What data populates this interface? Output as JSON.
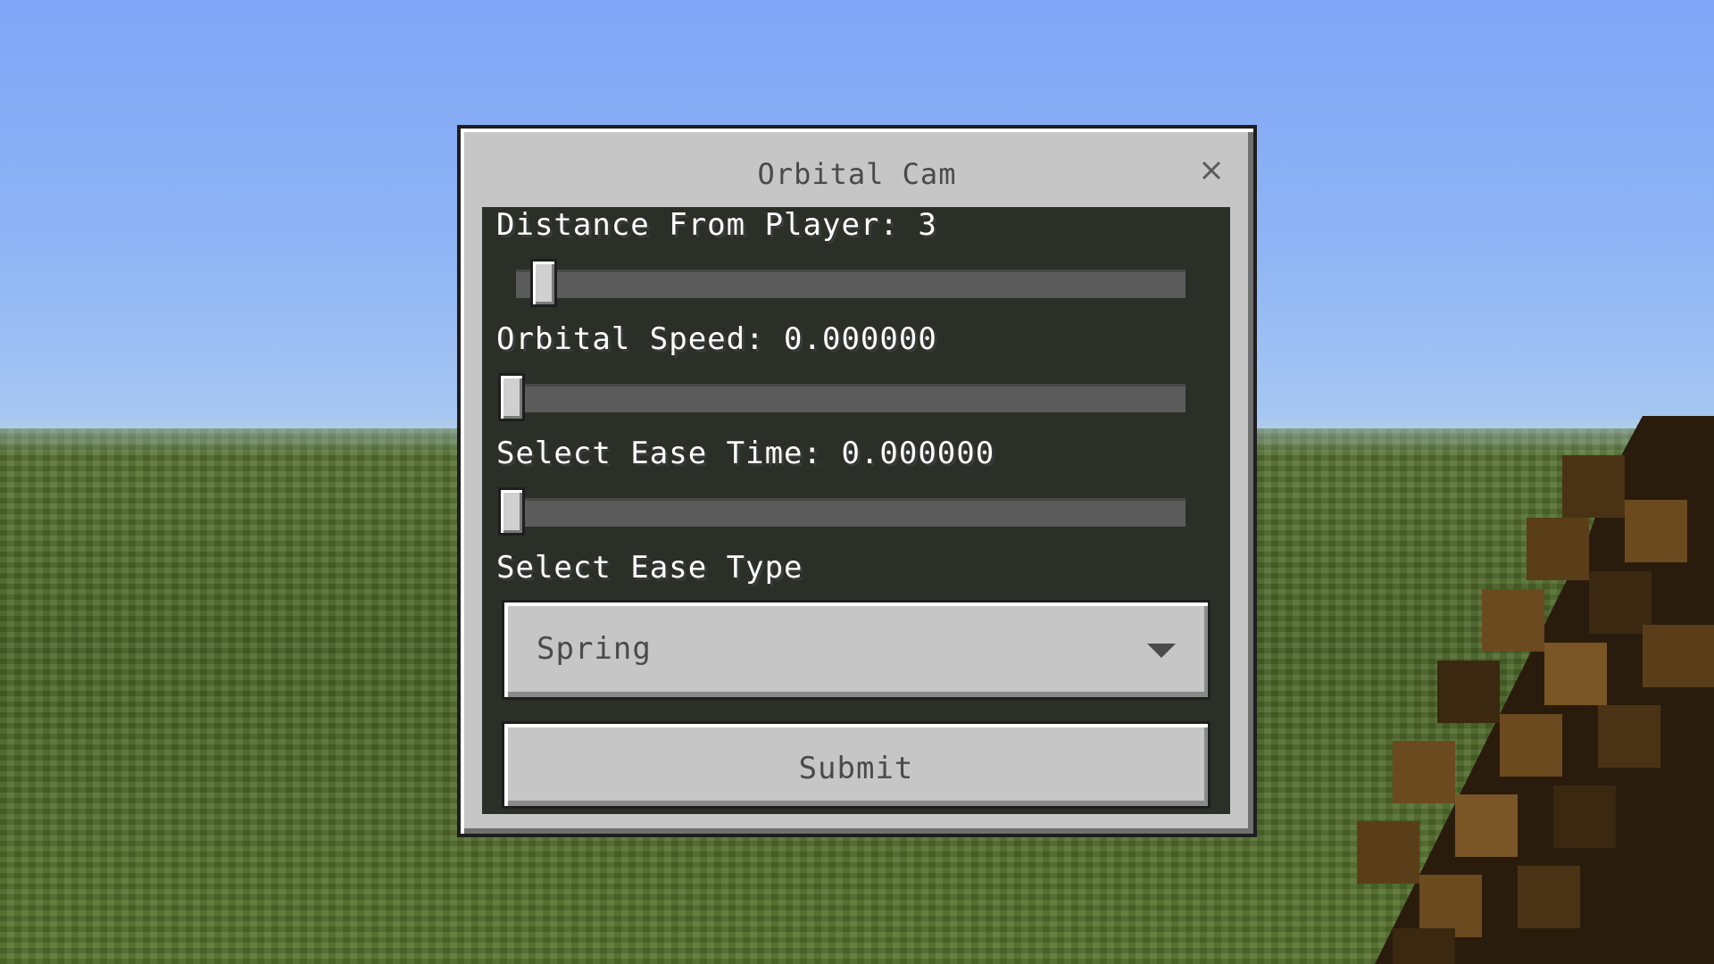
{
  "dialog": {
    "title": "Orbital Cam",
    "close_icon": "close-icon"
  },
  "controls": {
    "distance": {
      "label": "Distance From Player: 3",
      "value": 3,
      "slider_fraction": 0.05
    },
    "speed": {
      "label": "Orbital Speed: 0.000000",
      "value": 0,
      "slider_fraction": 0
    },
    "ease_time": {
      "label": "Select Ease Time: 0.000000",
      "value": 0,
      "slider_fraction": 0
    },
    "ease_type": {
      "label": "Select Ease Type",
      "selected": "Spring",
      "arrow_icon": "triangle-down-icon"
    }
  },
  "submit": {
    "label": "Submit"
  },
  "scene": {
    "sky_color": "#8eb4f5",
    "grass_color": "#4f6b2c",
    "held_item": "stick"
  }
}
